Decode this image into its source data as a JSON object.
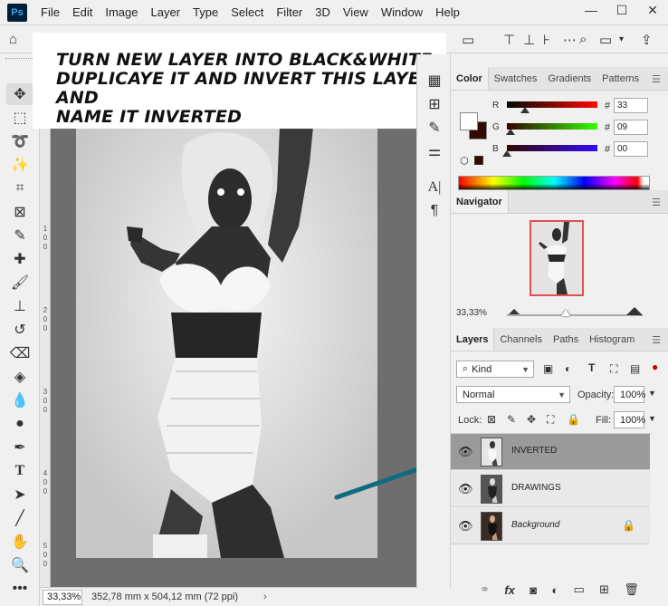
{
  "menu": {
    "app_logo": "Ps",
    "items": [
      "File",
      "Edit",
      "Image",
      "Layer",
      "Type",
      "Select",
      "Filter",
      "3D",
      "View",
      "Window",
      "Help"
    ]
  },
  "window_controls": {
    "minimize": "—",
    "maximize": "☐",
    "close": "✕"
  },
  "annotation": {
    "text": "TURN NEW LAYER INTO BLACK&WHITE\nDUPLICAYE IT AND INVERT THIS LAYER AND\nNAME IT   INVERTED"
  },
  "ruler_left": {
    "digits_a": [
      "1",
      "0",
      "0"
    ],
    "digits_b": [
      "2",
      "0",
      "0"
    ],
    "digits_c": [
      "3",
      "0",
      "0"
    ],
    "digits_d": [
      "4",
      "0",
      "0"
    ],
    "digits_e": [
      "5",
      "0",
      "0"
    ]
  },
  "status": {
    "zoom": "33,33%",
    "doc_info": "352,78 mm x 504,12 mm (72 ppi)",
    "arrow": "›"
  },
  "color_panel": {
    "tabs": [
      "Color",
      "Swatches",
      "Gradients",
      "Patterns"
    ],
    "channels": [
      {
        "label": "R",
        "value": "33",
        "thumb_fraction": 0.2
      },
      {
        "label": "G",
        "value": "09",
        "thumb_fraction": 0.04
      },
      {
        "label": "B",
        "value": "00",
        "thumb_fraction": 0.0
      }
    ],
    "hash": "#",
    "foreground": "#ffffff",
    "background": "#330900"
  },
  "navigator": {
    "title": "Navigator",
    "zoom": "33,33%",
    "view_box_color": "#e45050"
  },
  "layers_panel": {
    "tabs": [
      "Layers",
      "Channels",
      "Paths",
      "Histogram"
    ],
    "kind_label": "Kind",
    "blend_mode": "Normal",
    "opacity_label": "Opacity:",
    "opacity_value": "100%",
    "lock_label": "Lock:",
    "fill_label": "Fill:",
    "fill_value": "100%",
    "layers": [
      {
        "name": "INVERTED",
        "selected": true,
        "italic": false,
        "locked": false
      },
      {
        "name": "DRAWINGS",
        "selected": false,
        "italic": false,
        "locked": false
      },
      {
        "name": "Background",
        "selected": false,
        "italic": true,
        "locked": true
      }
    ]
  },
  "colors": {
    "arrow": "#106b80",
    "panel_bg": "#f0f0f0",
    "canvas_bg": "#6e6e6e"
  }
}
